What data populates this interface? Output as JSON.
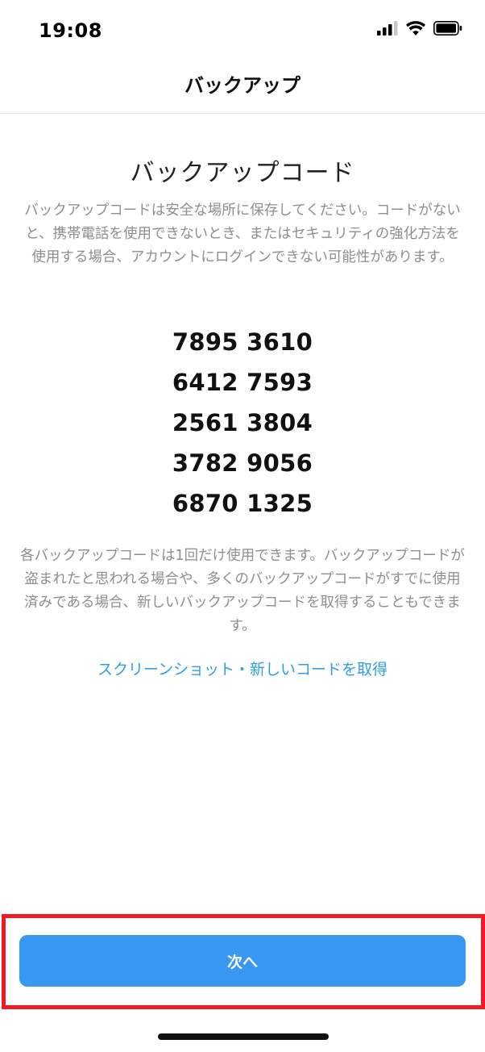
{
  "status_bar": {
    "time": "19:08",
    "icons": [
      "cellular-signal-icon",
      "wifi-icon",
      "battery-icon"
    ]
  },
  "nav": {
    "title": "バックアップ"
  },
  "main": {
    "heading": "バックアップコード",
    "description": "バックアップコードは安全な場所に保存してください。コードがないと、携帯電話を使用できないとき、またはセキュリティの強化方法を使用する場合、アカウントにログインできない可能性があります。",
    "codes": [
      "7895 3610",
      "6412 7593",
      "2561 3804",
      "3782 9056",
      "6870 1325"
    ],
    "note": "各バックアップコードは1回だけ使用できます。バックアップコードが盗まれたと思われる場合や、多くのバックアップコードがすでに使用済みである場合、新しいバックアップコードを取得することもできます。",
    "link_label": "スクリーンショット・新しいコードを取得"
  },
  "footer": {
    "next_label": "次へ"
  },
  "colors": {
    "accent": "#3897f0",
    "link": "#2f9ee6",
    "secondary_text": "#8e8e8e",
    "highlight": "#ee1b24"
  }
}
